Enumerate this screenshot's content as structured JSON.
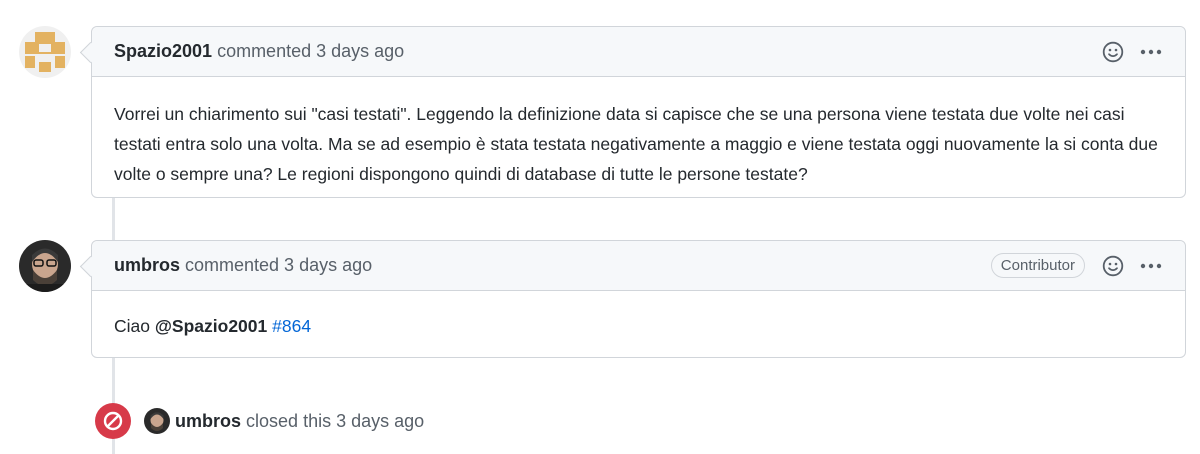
{
  "comments": [
    {
      "author": "Spazio2001",
      "meta": "commented 3 days ago",
      "badge": "",
      "body_text": "Vorrei un chiarimento sui \"casi testati\". Leggendo la definizione data si capisce che se una persona viene testata due volte nei casi testati entra solo una volta. Ma se ad esempio è stata testata negativamente a maggio e viene testata oggi nuovamente la si conta due volte o sempre una? Le regioni dispongono quindi di database di tutte le persone testate?"
    },
    {
      "author": "umbros",
      "meta": "commented 3 days ago",
      "badge": "Contributor",
      "body_prefix": "Ciao ",
      "body_mention": "@Spazio2001",
      "body_link": "#864"
    }
  ],
  "event": {
    "author": "umbros",
    "text": "closed this 3 days ago"
  },
  "colors": {
    "closed_badge": "#d73a49",
    "link": "#0366d6",
    "identicon": "#e3b261"
  },
  "icons": {
    "reaction": "smiley-icon",
    "menu": "kebab-horizontal-icon",
    "closed": "circle-slash-icon"
  }
}
